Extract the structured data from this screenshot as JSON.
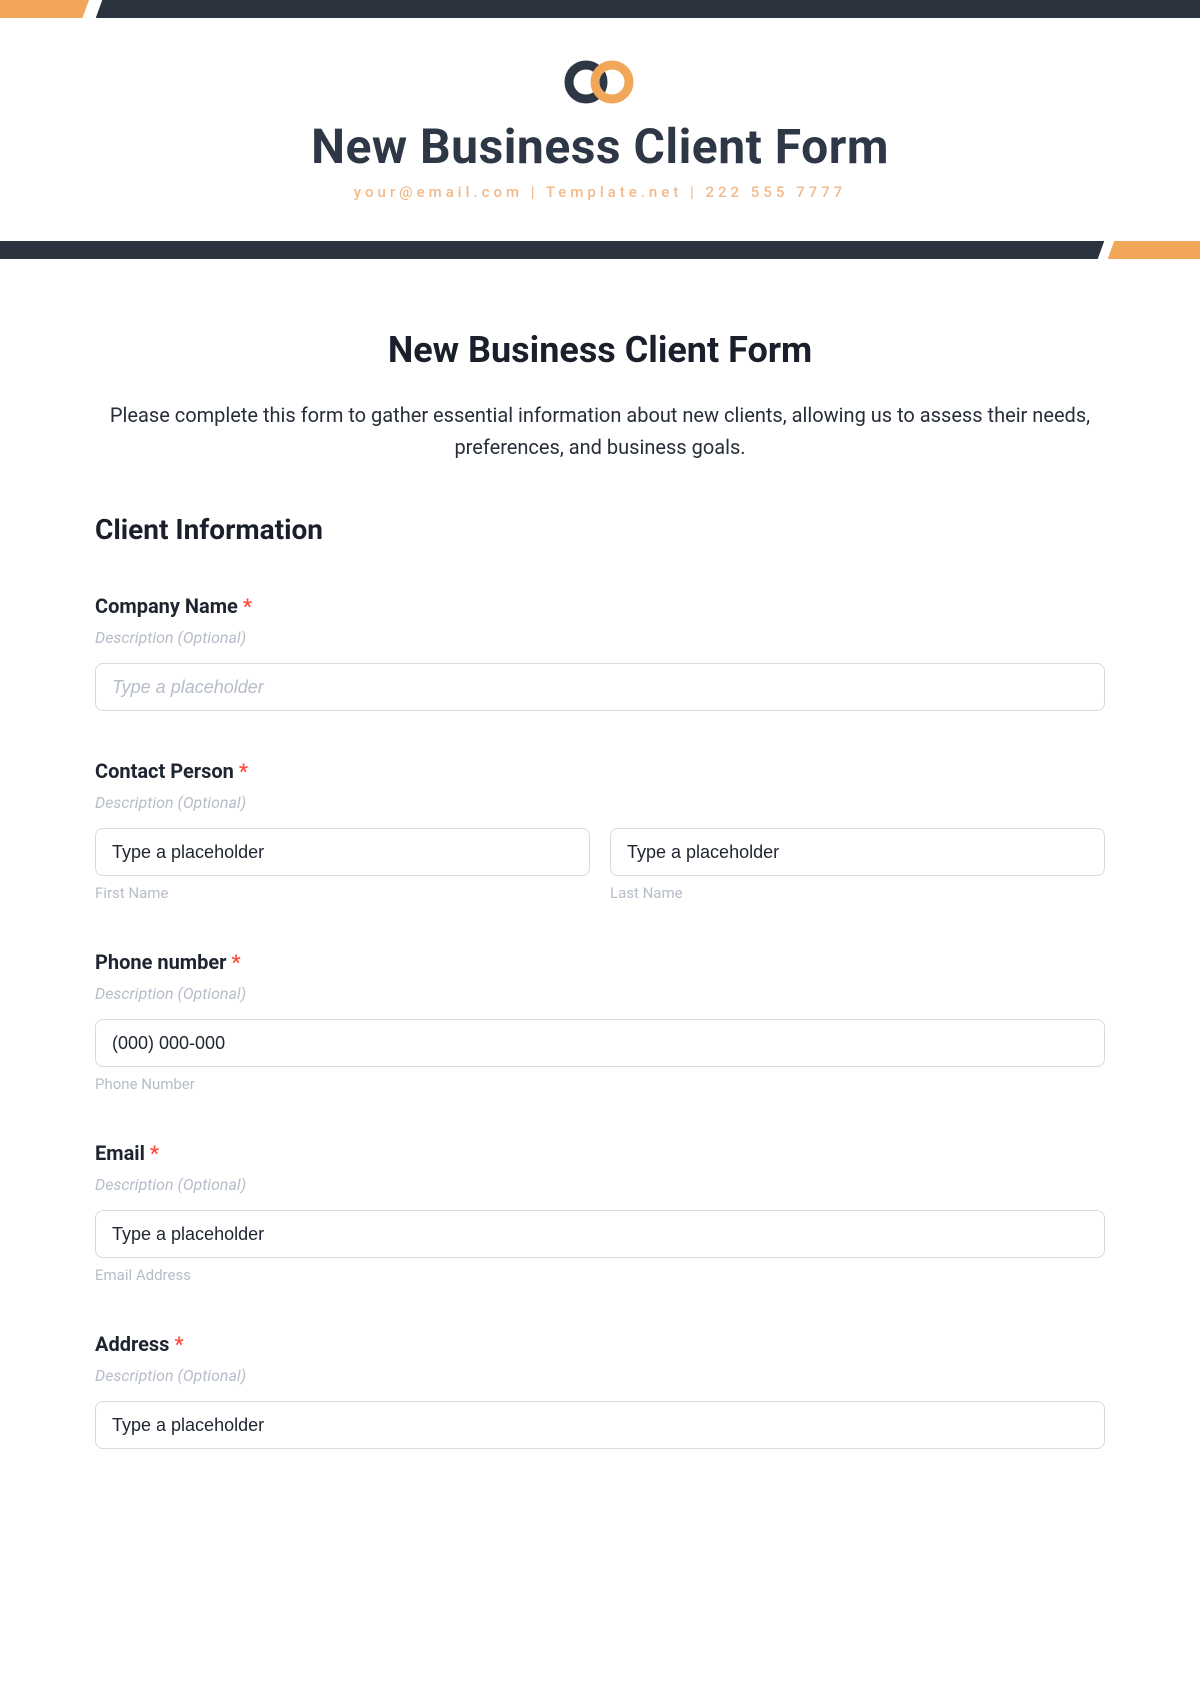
{
  "header": {
    "title": "New Business Client Form",
    "subline": "your@email.com | Template.net | 222 555 7777"
  },
  "form": {
    "title": "New Business Client Form",
    "description": "Please complete this form to gather essential information about new clients, allowing us to assess their needs, preferences, and business goals.",
    "section1_heading": "Client Information",
    "desc_placeholder": "Description (Optional)",
    "required": "*",
    "fields": {
      "company": {
        "label": "Company Name",
        "placeholder": "Type a placeholder"
      },
      "contact": {
        "label": "Contact Person",
        "first_ph": "Type a placeholder",
        "last_ph": "Type a placeholder",
        "first_sub": "First Name",
        "last_sub": "Last Name"
      },
      "phone": {
        "label": "Phone number",
        "placeholder": "(000) 000-000",
        "sub": "Phone Number"
      },
      "email": {
        "label": "Email",
        "placeholder": "Type a placeholder",
        "sub": "Email Address"
      },
      "address": {
        "label": "Address",
        "placeholder": "Type a placeholder"
      }
    }
  }
}
